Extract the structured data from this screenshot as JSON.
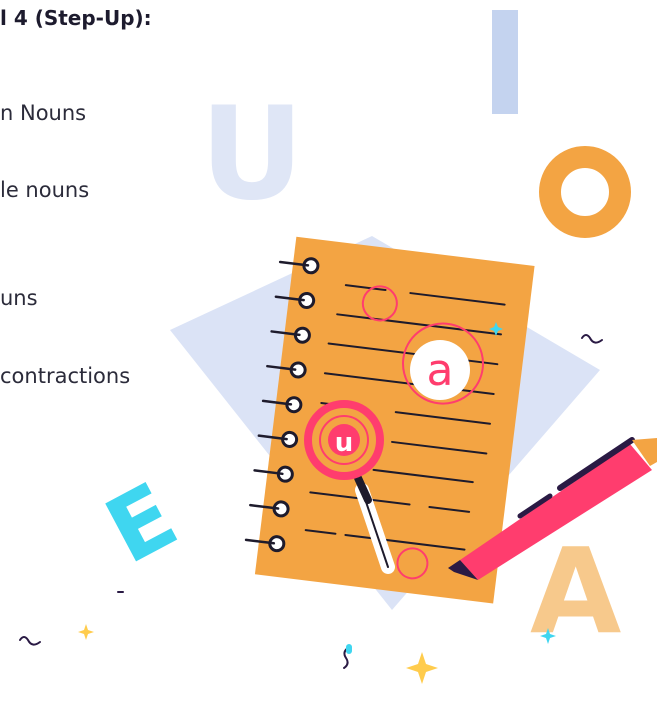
{
  "heading": "l 4 (Step-Up):",
  "items": [
    "n Nouns",
    "le nouns",
    "uns",
    " contractions"
  ],
  "letters": {
    "u_big": "U",
    "i_big": "I",
    "o_big": "O",
    "e_big": "E",
    "a_big": "A",
    "a_circle": "a",
    "u_circle": "u"
  },
  "colors": {
    "notebook": "#f3a443",
    "paper_back": "#dbe3f6",
    "pink": "#ff3d6e",
    "navy": "#2a1a44",
    "cyan": "#3fd6f0",
    "letter_u": "#dfe6f6",
    "letter_i": "#c4d3ef",
    "letter_o": "#f3a443",
    "letter_a": "#f7c98c",
    "star_yellow": "#ffcc4d"
  }
}
